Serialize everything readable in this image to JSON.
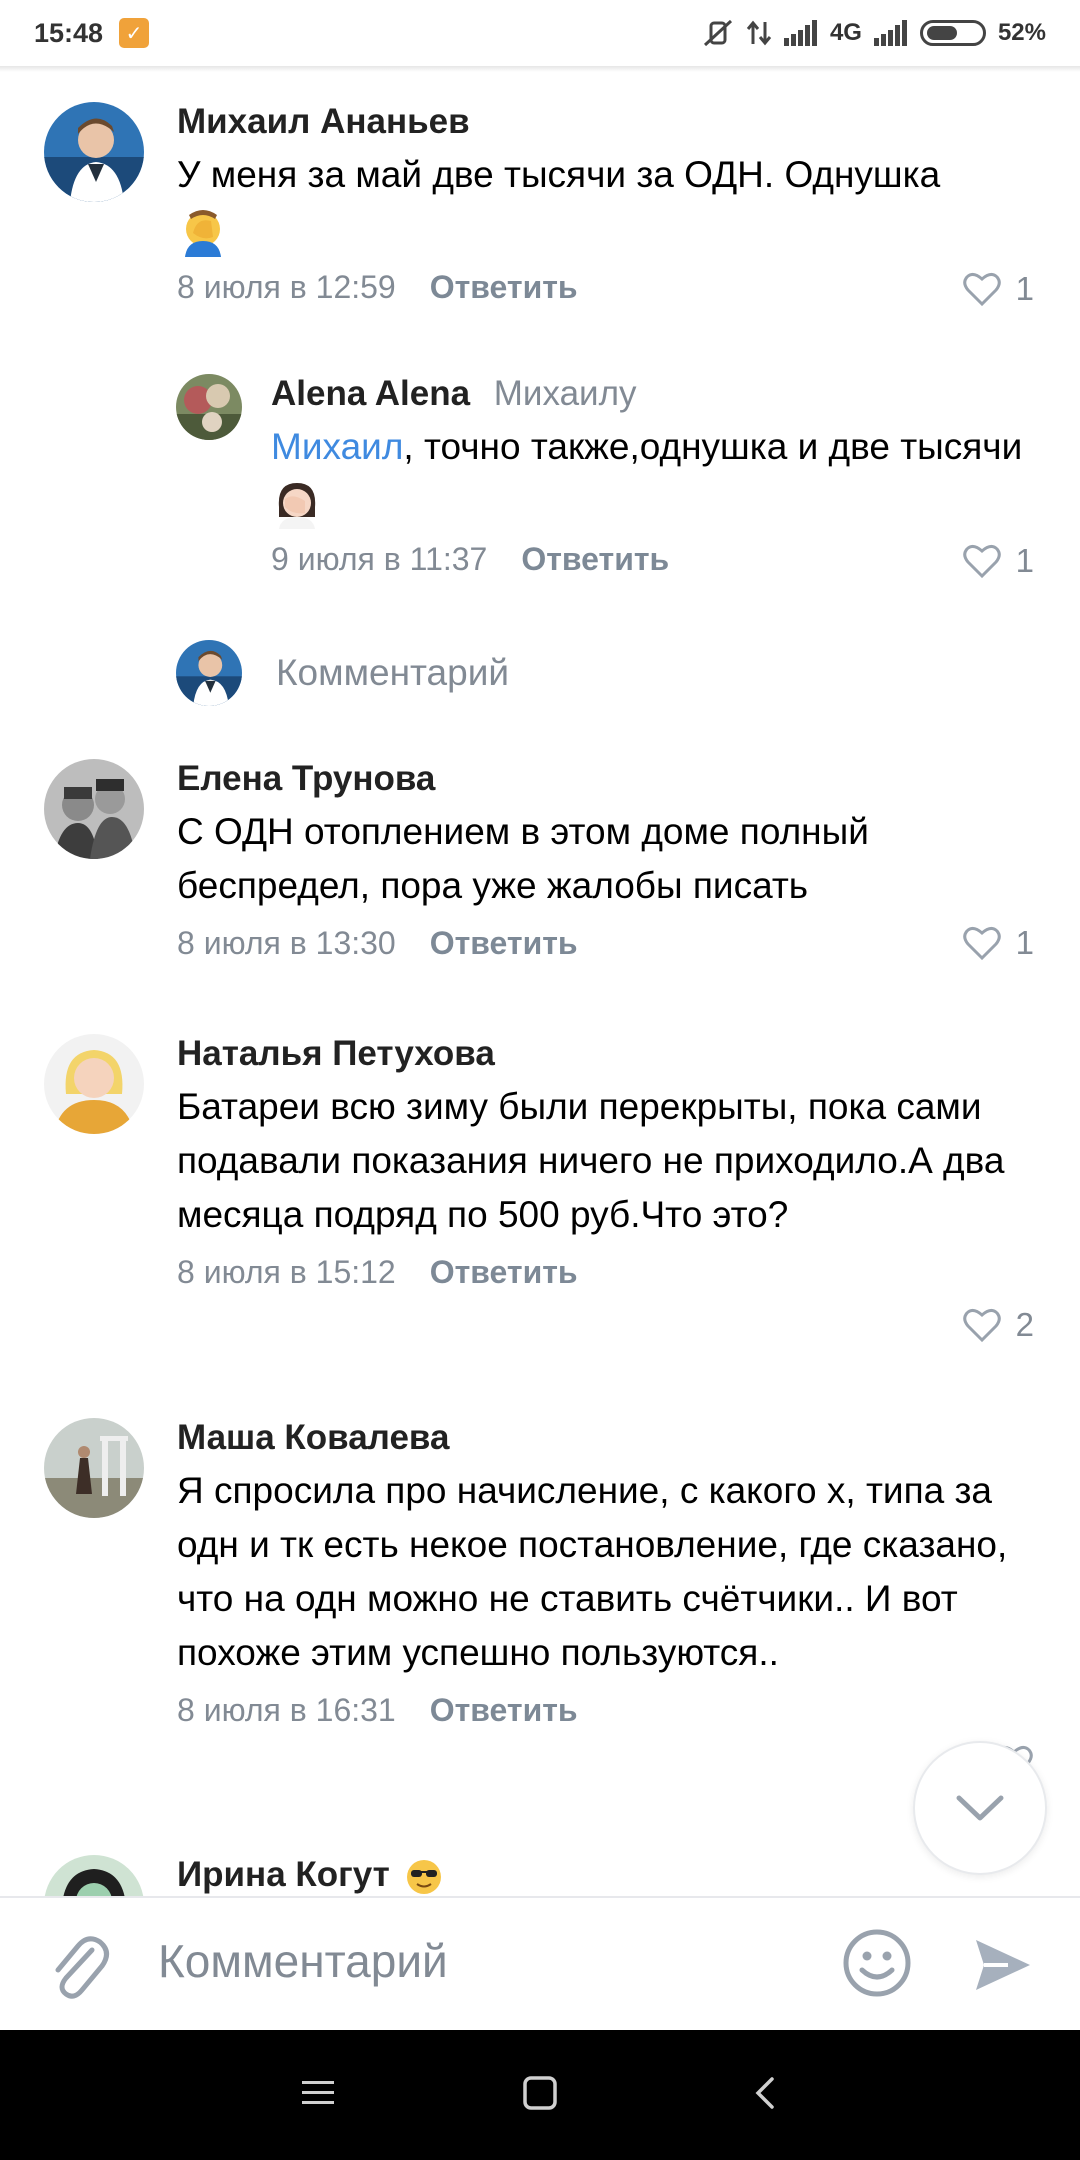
{
  "status_bar": {
    "time": "15:48",
    "network": "4G",
    "battery": "52%",
    "battery_level": 0.52
  },
  "comments": [
    {
      "author": "Михаил Ананьев",
      "text": "У меня за май две тысячи за ОДН. Однушка",
      "emoji": "facepalm",
      "date": "8 июля в 12:59",
      "reply_label": "Ответить",
      "likes": "1"
    },
    {
      "author": "Alena Alena",
      "reply_to": "Михаилу",
      "mention": "Михаил",
      "text": ", точно также,однушка и две тысячи",
      "emoji": "facepalm-woman",
      "date": "9 июля в 11:37",
      "reply_label": "Ответить",
      "likes": "1"
    },
    {
      "author": "Елена Трунова",
      "text": "С ОДН отоплением в этом доме полный беспредел, пора уже жалобы писать",
      "date": "8 июля в 13:30",
      "reply_label": "Ответить",
      "likes": "1"
    },
    {
      "author": "Наталья Петухова",
      "text": "Батареи всю зиму были перекрыты, пока сами подавали показания ничего не приходило.А два месяца подряд по 500 руб.Что это?",
      "date": "8 июля в 15:12",
      "reply_label": "Ответить",
      "likes": "2"
    },
    {
      "author": "Маша Ковалева",
      "text": "Я спросила про начисление, с какого х, типа за одн и тк есть некое постановление, где сказано, что на одн можно не ставить счётчики.. И вот похоже этим успешно пользуются..",
      "date": "8 июля в 16:31",
      "reply_label": "Ответить"
    },
    {
      "author": "Ирина Когут",
      "emoji": "sunglasses"
    }
  ],
  "reply_input": {
    "placeholder": "Комментарий"
  },
  "comment_bar": {
    "placeholder": "Комментарий"
  },
  "colors": {
    "accent": "#3f8ae0",
    "secondary_text": "#828a94",
    "icon": "#99a2ad"
  }
}
